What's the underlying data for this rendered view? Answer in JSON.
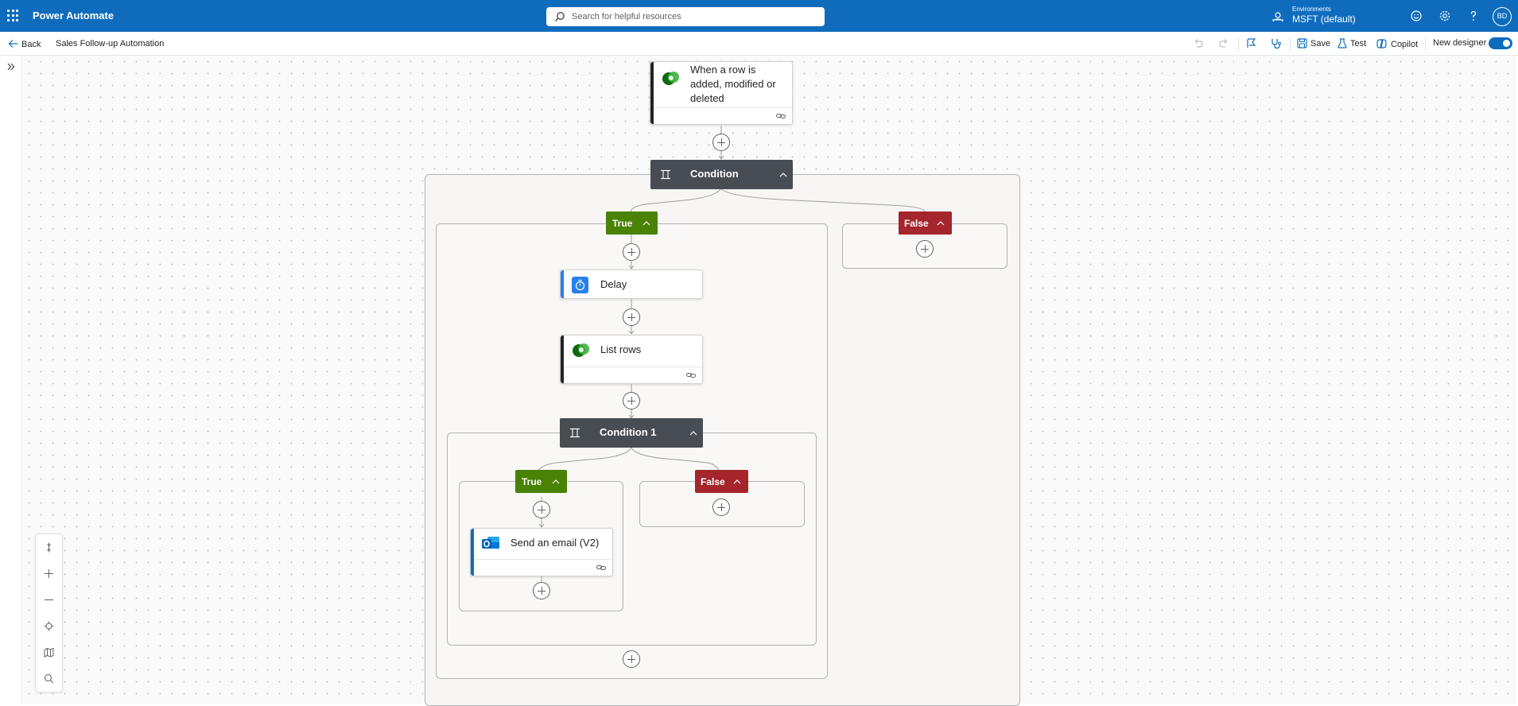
{
  "header": {
    "app_title": "Power Automate",
    "search_placeholder": "Search for helpful resources",
    "environment_label": "Environments",
    "environment_name": "MSFT (default)",
    "avatar_initials": "BD",
    "accent_color": "#0f6cbd"
  },
  "commandbar": {
    "back_label": "Back",
    "flow_name": "Sales Follow-up Automation",
    "save_label": "Save",
    "test_label": "Test",
    "copilot_label": "Copilot",
    "new_designer_label": "New designer",
    "new_designer_on": true
  },
  "flow": {
    "trigger": {
      "title": "When a row is added, modified or deleted",
      "icon": "dataverse-icon"
    },
    "condition": {
      "title": "Condition",
      "true_label": "True",
      "false_label": "False",
      "true_actions": {
        "delay": {
          "title": "Delay",
          "icon": "timer-icon",
          "color": "#2680eb"
        },
        "list_rows": {
          "title": "List rows",
          "icon": "dataverse-icon"
        },
        "condition1": {
          "title": "Condition 1",
          "true_label": "True",
          "false_label": "False",
          "send_email": {
            "title": "Send an email (V2)",
            "icon": "outlook-icon",
            "color": "#0f6cbd"
          }
        }
      }
    },
    "colors": {
      "true_branch": "#498205",
      "false_branch": "#a4262c",
      "condition": "#484c53"
    }
  },
  "zoom_controls": [
    "fit-view-icon",
    "zoom-in-icon",
    "zoom-out-icon",
    "center-icon",
    "minimap-icon",
    "search-icon"
  ]
}
